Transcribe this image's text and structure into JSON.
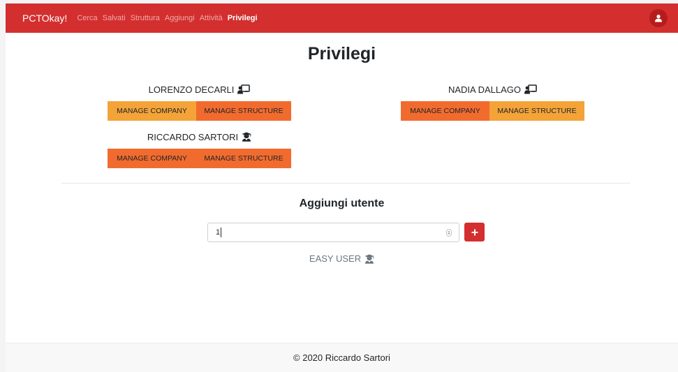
{
  "navbar": {
    "brand": "PCTOkay!",
    "links": [
      "Cerca",
      "Salvati",
      "Struttura",
      "Aggiungi",
      "Attività",
      "Privilegi"
    ],
    "active_link": "Privilegi",
    "avatar_icon": "user-icon"
  },
  "page": {
    "title": "Privilegi"
  },
  "users": [
    {
      "name": "LORENZO DECARLI",
      "role_icon": "teacher-icon",
      "buttons": [
        "MANAGE COMPANY",
        "MANAGE STRUCTURE"
      ],
      "company_active": false,
      "structure_active": true
    },
    {
      "name": "NADIA DALLAGO",
      "role_icon": "teacher-icon",
      "buttons": [
        "MANAGE COMPANY",
        "MANAGE STRUCTURE"
      ],
      "company_active": true,
      "structure_active": false
    },
    {
      "name": "RICCARDO SARTORI",
      "role_icon": "student-icon",
      "buttons": [
        "MANAGE COMPANY",
        "MANAGE STRUCTURE"
      ],
      "company_active": true,
      "structure_active": true
    }
  ],
  "add_user": {
    "title": "Aggiungi utente",
    "input_value": "1",
    "add_icon": "plus-icon",
    "result_name": "EASY USER",
    "result_icon": "student-icon"
  },
  "footer": {
    "text": "© 2020 Riccardo Sartori"
  },
  "colors": {
    "primary": "#d32f2f",
    "active_toggle": "#f26b2e",
    "inactive_toggle": "#f4a338"
  }
}
